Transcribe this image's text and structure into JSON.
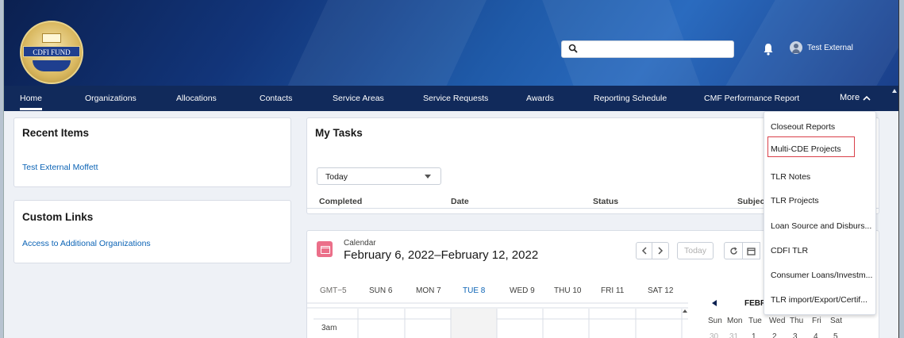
{
  "header": {
    "logo_text": "CDFI FUND",
    "user_name": "Test External"
  },
  "nav": {
    "items": [
      {
        "label": "Home"
      },
      {
        "label": "Organizations"
      },
      {
        "label": "Allocations"
      },
      {
        "label": "Contacts"
      },
      {
        "label": "Service Areas"
      },
      {
        "label": "Service Requests"
      },
      {
        "label": "Awards"
      },
      {
        "label": "Reporting Schedule"
      },
      {
        "label": "CMF Performance Report"
      }
    ],
    "more_label": "More"
  },
  "recent": {
    "title": "Recent Items",
    "items": [
      {
        "label": "Test External Moffett"
      }
    ]
  },
  "custom_links": {
    "title": "Custom Links",
    "items": [
      {
        "label": "Access to Additional Organizations"
      }
    ]
  },
  "tasks": {
    "title": "My Tasks",
    "filter_value": "Today",
    "columns": [
      "Completed",
      "Date",
      "Status",
      "Subject"
    ]
  },
  "calendar": {
    "label": "Calendar",
    "range": "February 6, 2022–February 12, 2022",
    "today_button": "Today",
    "timezone": "GMT−5",
    "days": [
      "SUN 6",
      "MON 7",
      "TUE 8",
      "WED 9",
      "THU 10",
      "FRI 11",
      "SAT 12"
    ],
    "time_label": "3am",
    "mini_month": "FEBRU",
    "mini_days": [
      "Sun",
      "Mon",
      "Tue",
      "Wed",
      "Thu",
      "Fri",
      "Sat"
    ],
    "mini_dates": [
      "30",
      "31",
      "1",
      "2",
      "3",
      "4",
      "5"
    ]
  },
  "more_menu": {
    "items": [
      {
        "label": "Closeout Reports"
      },
      {
        "label": "Multi-CDE Projects"
      },
      {
        "label": "TLR Notes"
      },
      {
        "label": "TLR Projects"
      },
      {
        "label": "Loan Source and Disburs..."
      },
      {
        "label": "CDFI TLR"
      },
      {
        "label": "Consumer Loans/Investm..."
      },
      {
        "label": "TLR import/Export/Certif..."
      }
    ]
  },
  "colors": {
    "nav_bg": "#112a5b",
    "link": "#0b63b5",
    "highlight": "#d9404a",
    "calendar_icon": "#eb6f89"
  }
}
